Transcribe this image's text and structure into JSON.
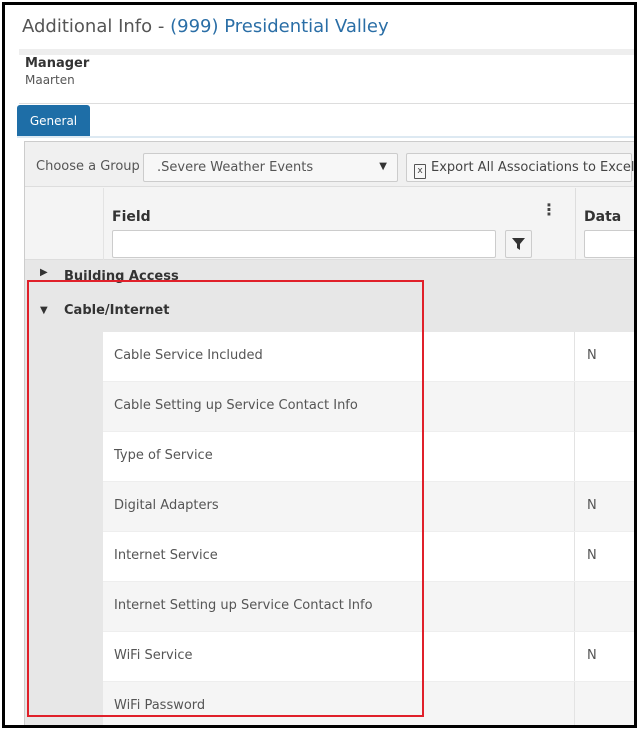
{
  "header": {
    "title_prefix": "Additional Info - ",
    "property_name": "(999) Presidential Valley"
  },
  "manager": {
    "label": "Manager",
    "value": "Maarten"
  },
  "tabs": [
    {
      "label": "General",
      "active": true
    }
  ],
  "toolbar": {
    "group_label": "Choose a Group",
    "group_selected": ".Severe Weather Events",
    "export_label": "Export All Associations to Excel",
    "export_icon": "excel-icon"
  },
  "grid": {
    "columns": [
      {
        "label": "Field"
      },
      {
        "label": "Data"
      }
    ],
    "filter_icon": "filter-icon",
    "menu_icon": "column-menu-icon",
    "groups": [
      {
        "label": "Building Access",
        "expanded": false
      },
      {
        "label": "Cable/Internet",
        "expanded": true
      }
    ],
    "rows": [
      {
        "field": "Cable Service Included",
        "data": "N"
      },
      {
        "field": "Cable Setting up Service Contact Info",
        "data": ""
      },
      {
        "field": "Type of Service",
        "data": ""
      },
      {
        "field": "Digital Adapters",
        "data": "N"
      },
      {
        "field": "Internet Service",
        "data": "N"
      },
      {
        "field": "Internet Setting up Service Contact Info",
        "data": ""
      },
      {
        "field": "WiFi Service",
        "data": "N"
      },
      {
        "field": "WiFi Password",
        "data": ""
      }
    ]
  },
  "colors": {
    "accent": "#1e6ea7",
    "highlight": "#e0202a"
  }
}
